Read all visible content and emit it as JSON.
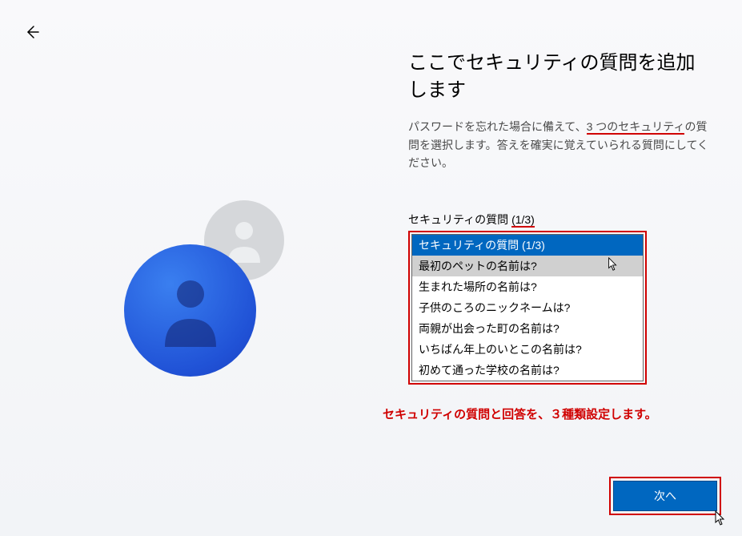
{
  "title": "ここでセキュリティの質問を追加します",
  "description_parts": {
    "prefix": "パスワードを忘れた場合に備えて、",
    "underlined": "3 つのセキュリティ",
    "suffix": "の質問を選択します。答えを確実に覚えていられる質問にしてください。"
  },
  "question_label_parts": {
    "prefix": "セキュリティの質問 ",
    "underlined": "(1/3)"
  },
  "dropdown": {
    "options": [
      "セキュリティの質問 (1/3)",
      "最初のペットの名前は?",
      "生まれた場所の名前は?",
      "子供のころのニックネームは?",
      "両親が出会った町の名前は?",
      "いちばん年上のいとこの名前は?",
      "初めて通った学校の名前は?"
    ],
    "selected_index": 0,
    "hovered_index": 1
  },
  "annotation": "セキュリティの質問と回答を、３種類設定します。",
  "next_button": "次へ"
}
